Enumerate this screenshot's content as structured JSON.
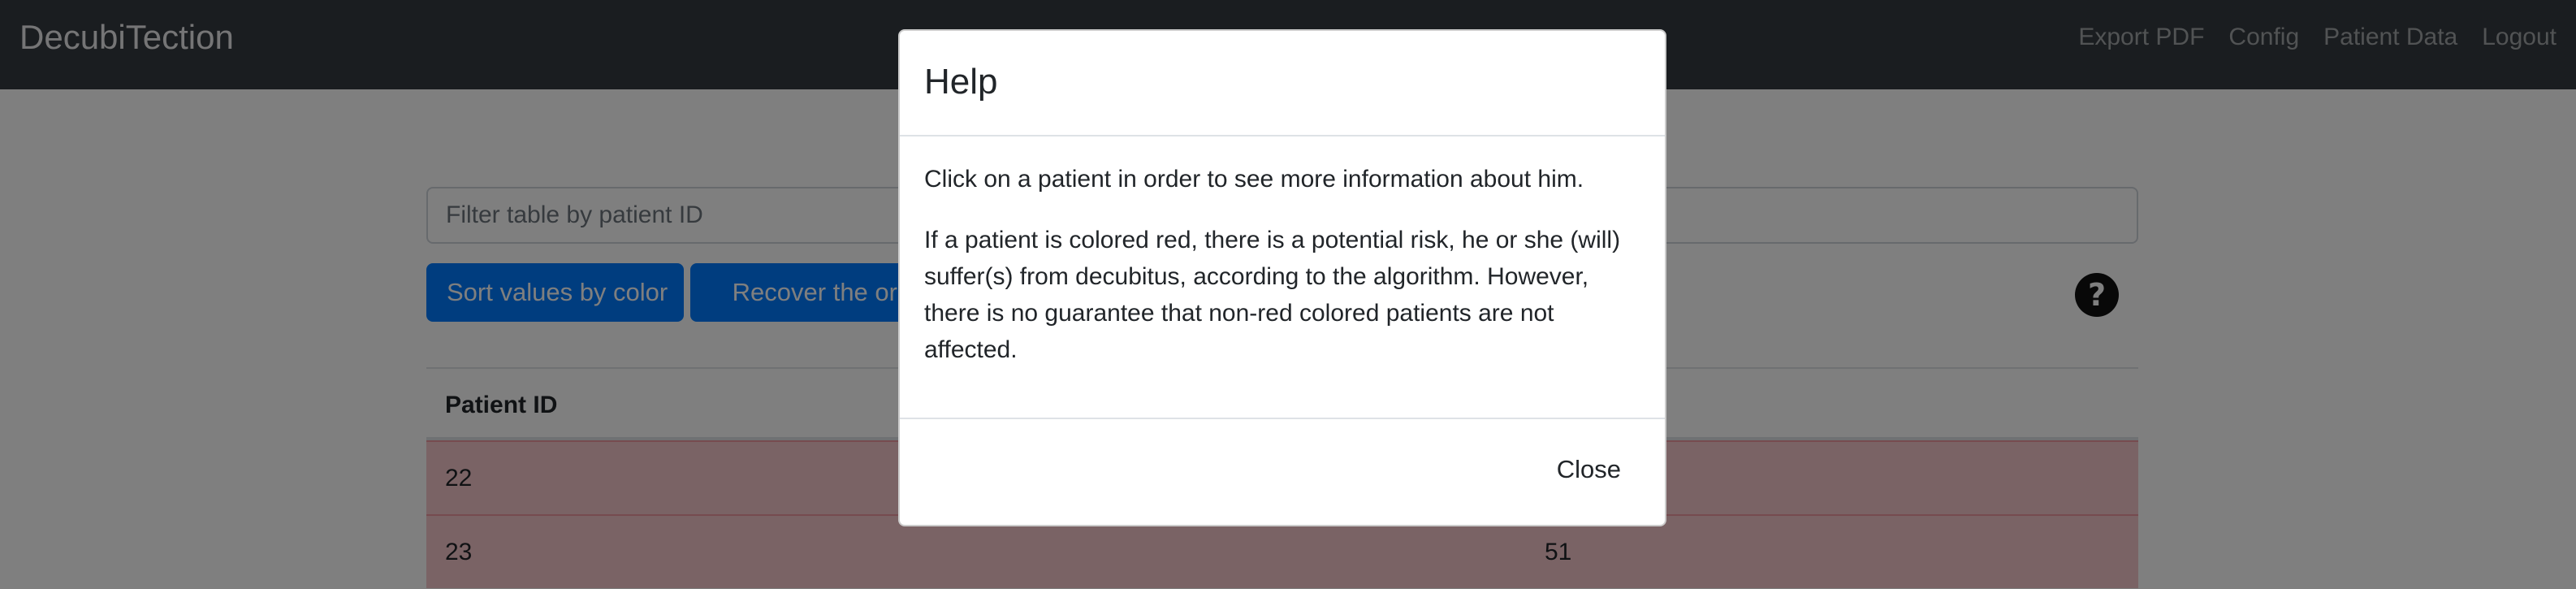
{
  "navbar": {
    "brand": "DecubiTection",
    "links": [
      "Export PDF",
      "Config",
      "Patient Data",
      "Logout"
    ]
  },
  "toolbar": {
    "filter_placeholder": "Filter table by patient ID",
    "sort_label": "Sort values by color",
    "recover_label": "Recover the original order",
    "help_icon": "question-circle-icon"
  },
  "table": {
    "header": "Patient ID",
    "rows": [
      {
        "id": "22",
        "value": ""
      },
      {
        "id": "23",
        "value": "51"
      }
    ],
    "row_color": "#f5c6cb"
  },
  "modal": {
    "title": "Help",
    "paragraphs": [
      "Click on a patient in order to see more information about him.",
      "If a patient is colored red, there is a potential risk, he or she (will) suffer(s) from decubitus, according to the algorithm. However, there is no guarantee that non-red colored patients are not affected."
    ],
    "close_label": "Close"
  },
  "colors": {
    "navbar": "#343a40",
    "primary": "#007bff",
    "danger_row": "#f5c6cb"
  }
}
